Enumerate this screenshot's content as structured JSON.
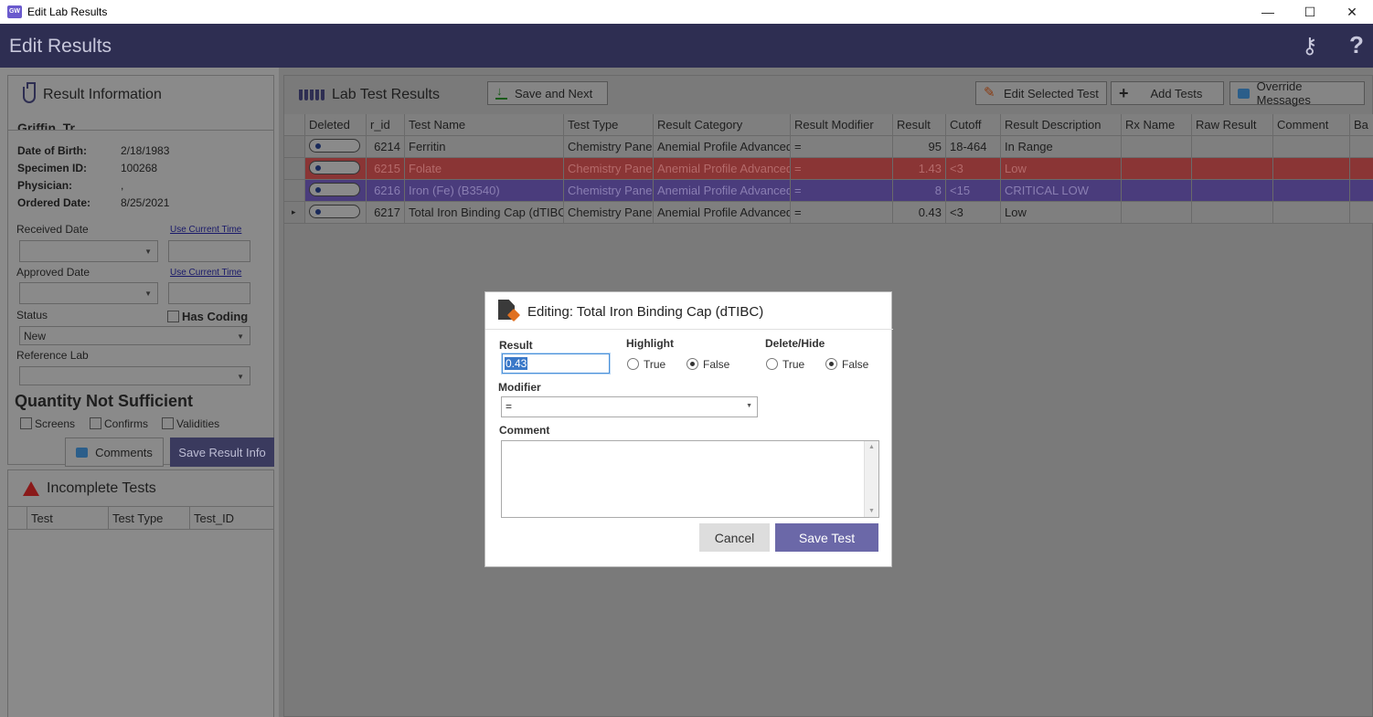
{
  "window": {
    "title": "Edit Lab Results",
    "app_icon_text": "GW",
    "minimize": "—",
    "maximize": "☐",
    "close": "✕"
  },
  "header": {
    "title": "Edit Results",
    "keys_glyph": "⚷",
    "help_glyph": "?"
  },
  "result_info": {
    "title": "Result Information",
    "patient_name_partial": "Griffin, Tr...",
    "fields": [
      {
        "label": "Date of Birth:",
        "value": "2/18/1983"
      },
      {
        "label": "Specimen ID:",
        "value": "100268"
      },
      {
        "label": "Physician:",
        "value": ","
      },
      {
        "label": "Ordered Date:",
        "value": "8/25/2021"
      }
    ],
    "received_date_label": "Received Date",
    "approved_date_label": "Approved Date",
    "use_current_time": "Use Current Time",
    "status_label": "Status",
    "status_value": "New",
    "has_coding_label": "Has Coding",
    "reference_lab_label": "Reference Lab",
    "qns_title": "Quantity Not Sufficient",
    "qns_options": [
      "Screens",
      "Confirms",
      "Validities"
    ],
    "comments_button": "Comments",
    "save_result_info_button": "Save Result Info"
  },
  "incomplete_tests": {
    "title": "Incomplete Tests",
    "columns": [
      "Test",
      "Test Type",
      "Test_ID"
    ]
  },
  "lab_results": {
    "title": "Lab Test Results",
    "save_and_next": "Save and Next",
    "edit_selected": "Edit Selected Test",
    "add_tests": "Add Tests",
    "override_messages": "Override Messages",
    "columns": [
      "Deleted",
      "r_id",
      "Test Name",
      "Test Type",
      "Result Category",
      "Result Modifier",
      "Result",
      "Cutoff",
      "Result Description",
      "Rx Name",
      "Raw Result",
      "Comment",
      "Ba"
    ],
    "rows": [
      {
        "r_id": "6214",
        "test_name": "Ferritin",
        "test_type": "Chemistry Panel",
        "category": "Anemial Profile Advanced",
        "modifier": "=",
        "result": "95",
        "cutoff": "18-464",
        "description": "In Range",
        "style": "normal",
        "marker": ""
      },
      {
        "r_id": "6215",
        "test_name": "Folate",
        "test_type": "Chemistry Panel",
        "category": "Anemial Profile Advanced",
        "modifier": "=",
        "result": "1.43",
        "cutoff": "<3",
        "description": "Low",
        "style": "red",
        "marker": ""
      },
      {
        "r_id": "6216",
        "test_name": "Iron (Fe) (B3540)",
        "test_type": "Chemistry Panel",
        "category": "Anemial Profile Advanced",
        "modifier": "=",
        "result": "8",
        "cutoff": "<15",
        "description": "CRITICAL LOW",
        "style": "purple",
        "marker": ""
      },
      {
        "r_id": "6217",
        "test_name": "Total Iron Binding Cap (dTIBC)",
        "test_type": "Chemistry Panel",
        "category": "Anemial Profile Advanced",
        "modifier": "=",
        "result": "0.43",
        "cutoff": "<3",
        "description": "Low",
        "style": "normal",
        "marker": "▸"
      }
    ]
  },
  "modal": {
    "title": "Editing: Total Iron Binding Cap (dTIBC)",
    "result_label": "Result",
    "result_value": "0.43",
    "highlight_label": "Highlight",
    "delete_hide_label": "Delete/Hide",
    "true_label": "True",
    "false_label": "False",
    "modifier_label": "Modifier",
    "modifier_value": "=",
    "comment_label": "Comment",
    "cancel": "Cancel",
    "save_test": "Save Test"
  },
  "colors": {
    "header_bg": "#2e2e52",
    "row_red": "#8a3535",
    "row_purple": "#4a3c7c",
    "save_test_btn": "#6b68a8"
  }
}
